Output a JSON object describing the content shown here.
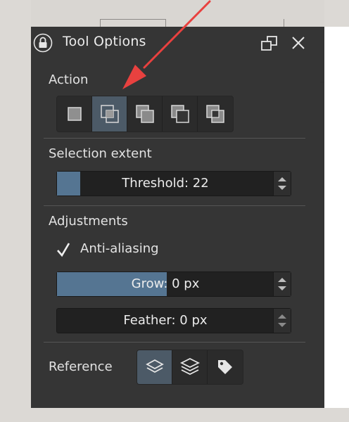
{
  "panel": {
    "title": "Tool Options"
  },
  "action": {
    "label": "Action",
    "modes": [
      {
        "icon": "replace-selection-icon",
        "active": false
      },
      {
        "icon": "intersect-selection-icon",
        "active": true
      },
      {
        "icon": "add-selection-icon",
        "active": false
      },
      {
        "icon": "subtract-selection-icon",
        "active": false
      },
      {
        "icon": "symmetric-difference-icon",
        "active": false
      }
    ]
  },
  "selection_extent": {
    "label": "Selection extent",
    "threshold_text": "Threshold: 22",
    "threshold_value": 22
  },
  "adjustments": {
    "label": "Adjustments",
    "antialias_label": "Anti-aliasing",
    "antialias_checked": true,
    "grow_text": "Grow: 0 px",
    "grow_value": 0,
    "feather_text": "Feather: 0 px",
    "feather_value": 0
  },
  "reference": {
    "label": "Reference",
    "options": [
      {
        "icon": "current-layer-icon",
        "active": true
      },
      {
        "icon": "all-layers-icon",
        "active": false
      },
      {
        "icon": "color-label-icon",
        "active": false
      }
    ]
  },
  "colors": {
    "panel_bg": "#353535",
    "accent": "#557592",
    "active_button": "#4c5a67",
    "annotation_arrow": "#e8413f"
  }
}
